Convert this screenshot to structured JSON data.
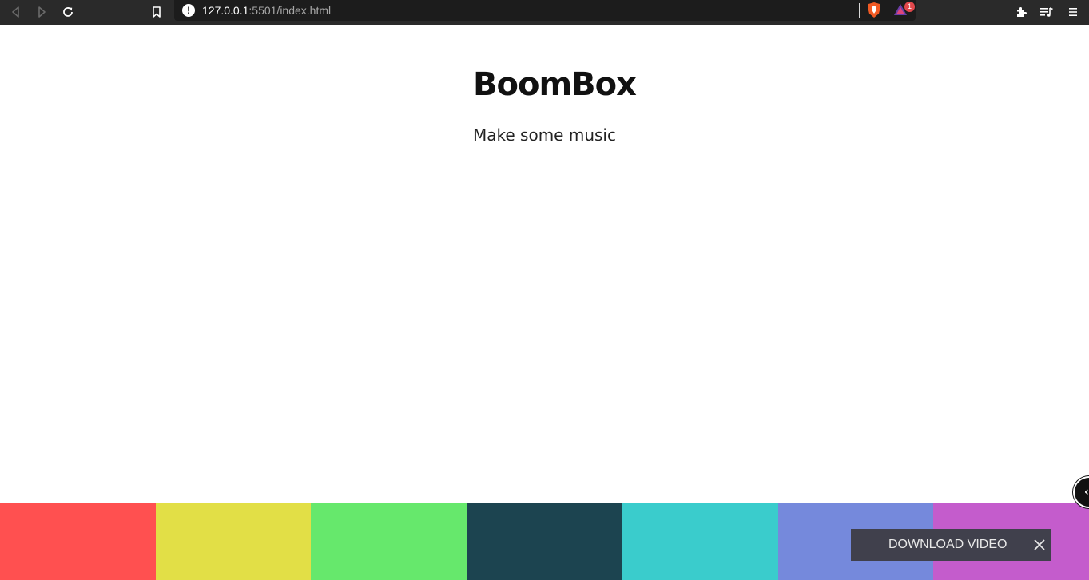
{
  "browser": {
    "url_host": "127.0.0.1",
    "url_path": ":5501/index.html",
    "rewards_badge": "1",
    "icons": [
      "back-icon",
      "forward-icon",
      "reload-icon",
      "bookmark-icon",
      "site-info-icon",
      "brave-shield-icon",
      "brave-rewards-icon",
      "extensions-icon",
      "media-queue-icon",
      "menu-icon"
    ]
  },
  "page": {
    "title": "BoomBox",
    "subtitle": "Make some music"
  },
  "pads": [
    {
      "color": "#ff5050"
    },
    {
      "color": "#e2df46"
    },
    {
      "color": "#66e86c"
    },
    {
      "color": "#1c4450"
    },
    {
      "color": "#3acccc"
    },
    {
      "color": "#7589dc"
    },
    {
      "color": "#c45ccc"
    }
  ],
  "overlay": {
    "download_label": "DOWNLOAD VIDEO",
    "background": "#40404c"
  }
}
